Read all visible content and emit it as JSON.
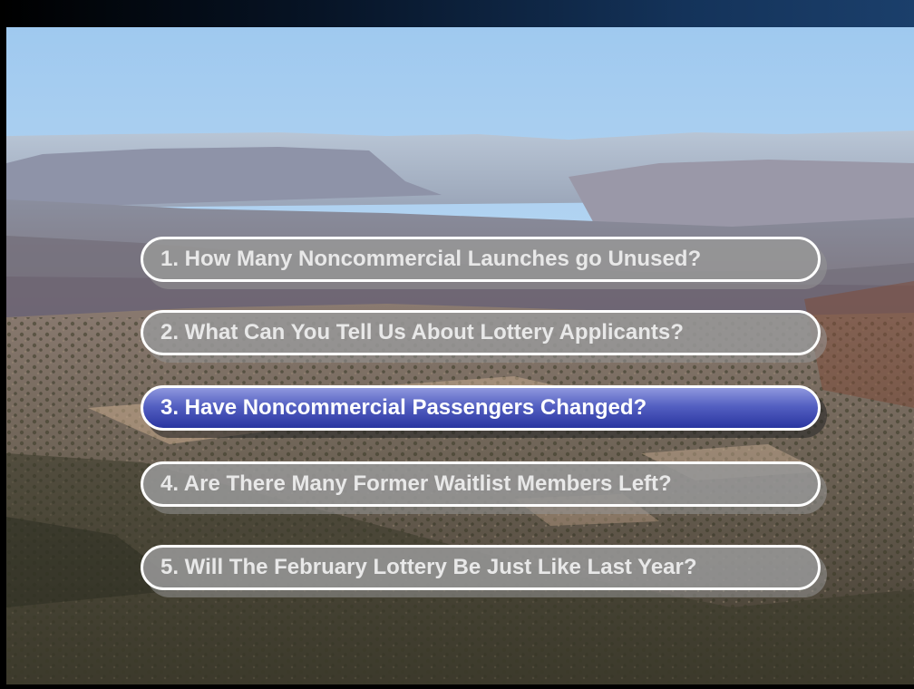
{
  "slide": {
    "background_image": "canyon-landscape-photo",
    "title_bar_color": "#14335a",
    "active_color": "#3a46b0",
    "inactive_color": "#969696"
  },
  "agenda": {
    "items": [
      {
        "label": "1. How Many Noncommercial Launches go Unused?",
        "active": false
      },
      {
        "label": "2. What Can You Tell Us About Lottery Applicants?",
        "active": false
      },
      {
        "label": "3. Have Noncommercial Passengers Changed?",
        "active": true
      },
      {
        "label": "4. Are There Many Former Waitlist Members Left?",
        "active": false
      },
      {
        "label": "5. Will The February Lottery Be Just Like Last Year?",
        "active": false
      }
    ]
  }
}
